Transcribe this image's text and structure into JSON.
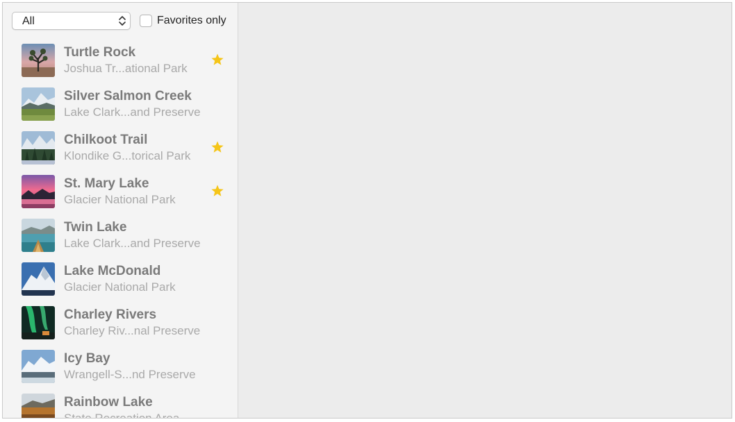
{
  "filter": {
    "selected": "All",
    "favorites_label": "Favorites only",
    "favorites_checked": false
  },
  "colors": {
    "star": "#f5c518",
    "name": "#7a7a7a",
    "subtitle": "#a9a9a9",
    "sidebar_bg": "#f4f4f4",
    "detail_bg": "#ececec"
  },
  "landmarks": [
    {
      "name": "Turtle Rock",
      "park": "Joshua Tr...ational Park",
      "favorite": true,
      "thumbnail": "desert-joshua-tree-photo"
    },
    {
      "name": "Silver Salmon Creek",
      "park": "Lake Clark...and Preserve",
      "favorite": false,
      "thumbnail": "meadow-mountain-photo"
    },
    {
      "name": "Chilkoot Trail",
      "park": "Klondike G...torical Park",
      "favorite": true,
      "thumbnail": "forest-peaks-photo"
    },
    {
      "name": "St. Mary Lake",
      "park": "Glacier National Park",
      "favorite": true,
      "thumbnail": "pink-sunset-lake-photo"
    },
    {
      "name": "Twin Lake",
      "park": "Lake Clark...and Preserve",
      "favorite": false,
      "thumbnail": "canoe-lake-photo"
    },
    {
      "name": "Lake McDonald",
      "park": "Glacier National Park",
      "favorite": false,
      "thumbnail": "snowy-mountain-photo"
    },
    {
      "name": "Charley Rivers",
      "park": "Charley Riv...nal Preserve",
      "favorite": false,
      "thumbnail": "aurora-cabin-photo"
    },
    {
      "name": "Icy Bay",
      "park": "Wrangell-S...nd Preserve",
      "favorite": false,
      "thumbnail": "icy-bay-mountain-photo"
    },
    {
      "name": "Rainbow Lake",
      "park": "State Recreation Area",
      "favorite": false,
      "thumbnail": "rainbow-lake-photo"
    }
  ]
}
